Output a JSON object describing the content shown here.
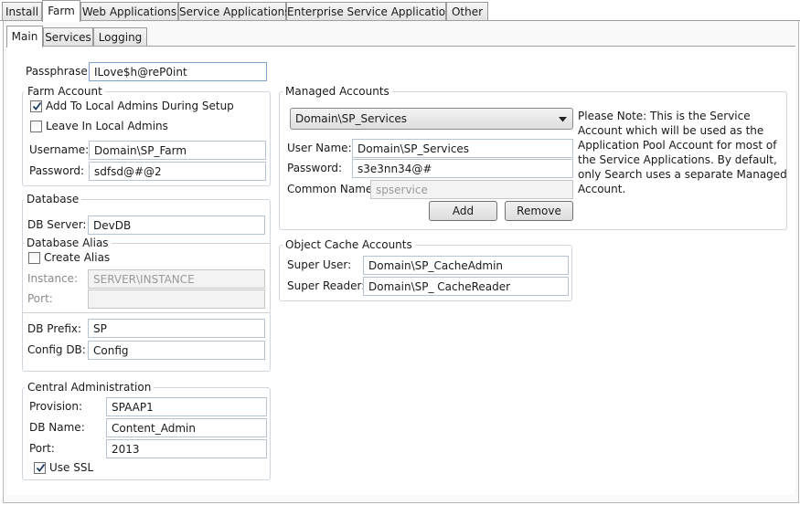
{
  "top_tabs": [
    "Install",
    "Farm",
    "Web Applications",
    "Service Applications",
    "Enterprise Service Applications",
    "Other"
  ],
  "sub_tabs": [
    "Main",
    "Services",
    "Logging"
  ],
  "passphrase": {
    "label": "Passphrase:",
    "value": "ILove$h@reP0int"
  },
  "farm_account": {
    "legend": "Farm Account",
    "add_local_admins": {
      "label": "Add To Local Admins During Setup",
      "checked": true
    },
    "leave_local_admins": {
      "label": "Leave In Local Admins",
      "checked": false
    },
    "username_label": "Username:",
    "username": "Domain\\SP_Farm",
    "password_label": "Password:",
    "password": "sdfsd@#@2"
  },
  "database": {
    "legend": "Database",
    "db_server_label": "DB Server:",
    "db_server": "DevDB",
    "alias_legend": "Database Alias",
    "create_alias": {
      "label": "Create Alias",
      "checked": false
    },
    "instance_label": "Instance:",
    "instance": "SERVER\\INSTANCE",
    "port_label": "Port:",
    "port": "",
    "db_prefix_label": "DB Prefix:",
    "db_prefix": "SP",
    "config_db_label": "Config DB:",
    "config_db": "Config"
  },
  "central_admin": {
    "legend": "Central Administration",
    "provision_label": "Provision:",
    "provision": "SPAAP1",
    "db_name_label": "DB Name:",
    "db_name": "Content_Admin",
    "port_label": "Port:",
    "port": "2013",
    "use_ssl": {
      "label": "Use SSL",
      "checked": true
    }
  },
  "managed_accounts": {
    "legend": "Managed Accounts",
    "selected": "Domain\\SP_Services",
    "user_name_label": "User Name:",
    "user_name": "Domain\\SP_Services",
    "password_label": "Password:",
    "password": "s3e3nn34@#",
    "common_name_label": "Common Name:",
    "common_name": "spservice",
    "add_button": "Add",
    "remove_button": "Remove",
    "note": "Please Note: This is the Service Account which will be used as the Application Pool Account for most of the Service Applications. By default, only Search uses a separate Managed Account."
  },
  "object_cache": {
    "legend": "Object Cache Accounts",
    "super_user_label": "Super User:",
    "super_user": "Domain\\SP_CacheAdmin",
    "super_reader_label": "Super Reader:",
    "super_reader": "Domain\\SP_ CacheReader"
  },
  "icons": {
    "check": "checkmark-icon",
    "dropdown": "chevron-down-icon"
  }
}
